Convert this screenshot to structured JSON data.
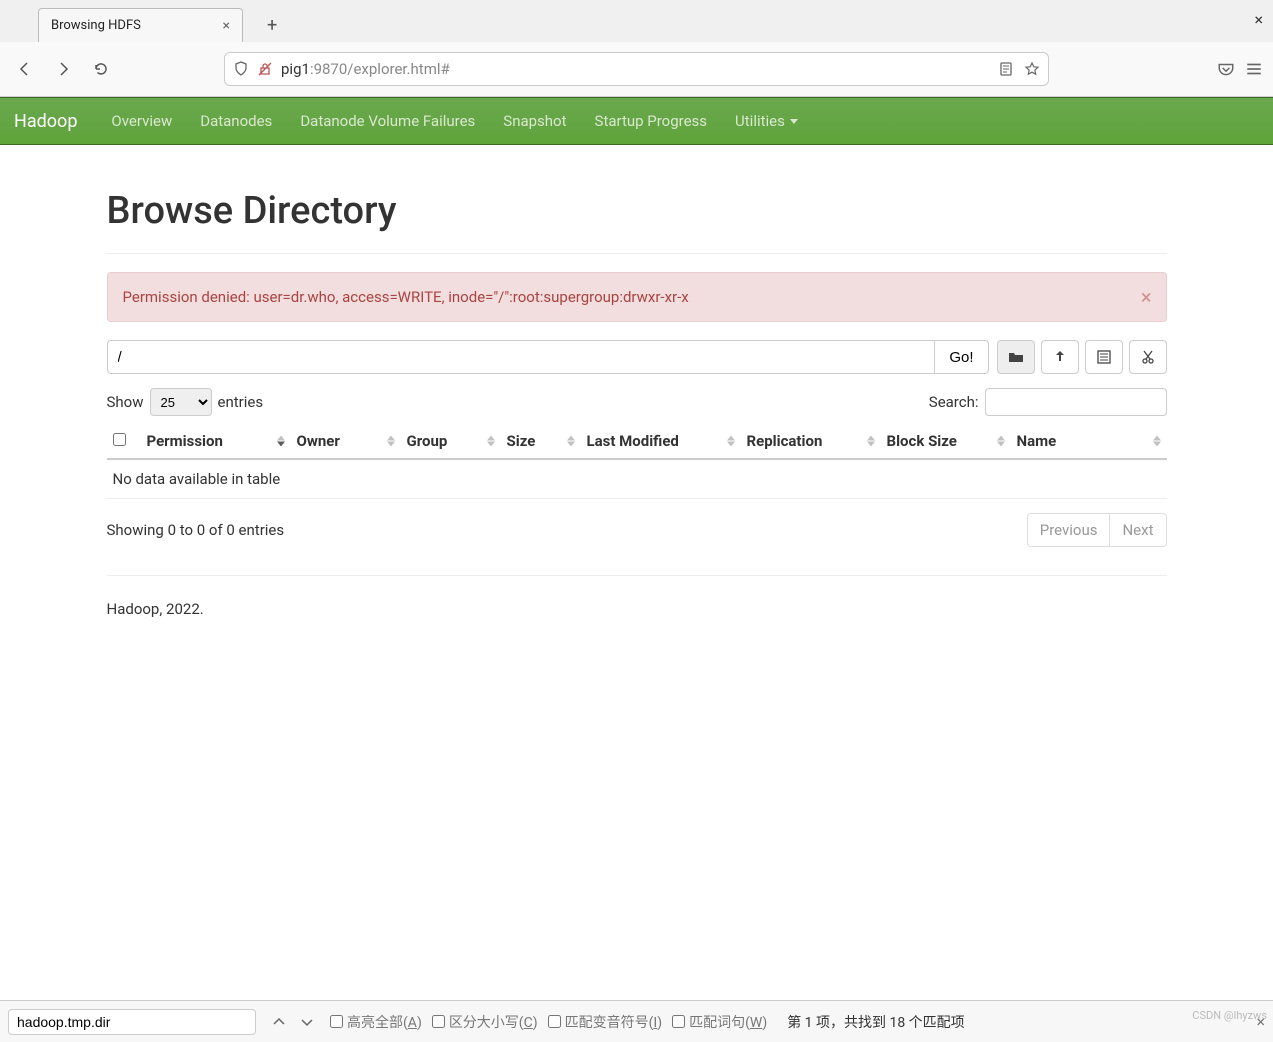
{
  "browser": {
    "tab_title": "Browsing HDFS",
    "url_host": "pig1",
    "url_rest": ":9870/explorer.html#"
  },
  "navbar": {
    "brand": "Hadoop",
    "items": [
      "Overview",
      "Datanodes",
      "Datanode Volume Failures",
      "Snapshot",
      "Startup Progress",
      "Utilities"
    ]
  },
  "page": {
    "title": "Browse Directory",
    "alert": "Permission denied: user=dr.who, access=WRITE, inode=\"/\":root:supergroup:drwxr-xr-x",
    "path_value": "/",
    "go_label": "Go!",
    "show_label": "Show",
    "entries_label": "entries",
    "page_length_value": "25",
    "search_label": "Search:",
    "columns": [
      "Permission",
      "Owner",
      "Group",
      "Size",
      "Last Modified",
      "Replication",
      "Block Size",
      "Name"
    ],
    "empty_message": "No data available in table",
    "info_text": "Showing 0 to 0 of 0 entries",
    "prev_label": "Previous",
    "next_label": "Next",
    "footer": "Hadoop, 2022."
  },
  "findbar": {
    "value": "hadoop.tmp.dir",
    "highlight_label": "高亮全部(",
    "highlight_key": "A",
    "case_label": "区分大小写(",
    "case_key": "C",
    "diacritics_label": "匹配变音符号(",
    "diacritics_key": "I",
    "whole_label": "匹配词句(",
    "whole_key": "W",
    "close_paren": ")",
    "status": "第 1 项，共找到 18 个匹配项"
  },
  "watermark": "CSDN @lhyzws"
}
